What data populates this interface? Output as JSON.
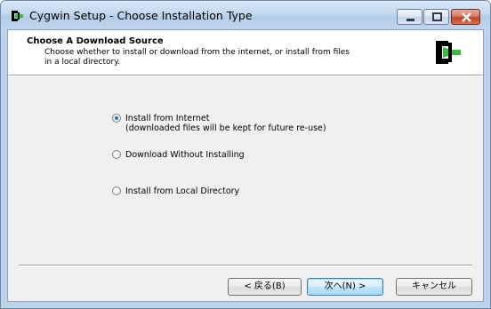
{
  "window": {
    "title": "Cygwin Setup - Choose Installation Type"
  },
  "header": {
    "title": "Choose  A Download Source",
    "description_line1": "Choose whether to install or download from the internet, or install from files",
    "description_line2": "in a local directory."
  },
  "options": [
    {
      "label": "Install from Internet",
      "sublabel": "(downloaded files will be kept for future re-use)",
      "selected": true
    },
    {
      "label": "Download Without Installing",
      "sublabel": "",
      "selected": false
    },
    {
      "label": "Install from Local Directory",
      "sublabel": "",
      "selected": false
    }
  ],
  "buttons": {
    "back": "< 戻る(B)",
    "next": "次へ(N) >",
    "cancel": "キャンセル"
  },
  "colors": {
    "logo_green": "#3dbb3d",
    "logo_black": "#000000",
    "close_red": "#c3442a"
  }
}
